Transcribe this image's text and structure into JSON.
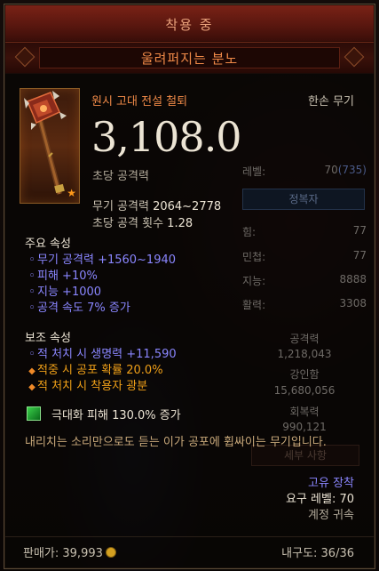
{
  "header": {
    "state_label": "착용 중",
    "item_name": "울려퍼지는 분노"
  },
  "item": {
    "type": "원시 고대 전설 철퇴",
    "slot": "한손 무기",
    "dps": "3,108.0",
    "dps_label": "초당 공격력",
    "weapon_damage_label": "무기 공격력",
    "weapon_damage_value": "2064~2778",
    "attacks_per_second_label": "초당 공격 횟수",
    "attacks_per_second_value": "1.28"
  },
  "primary": {
    "title": "주요 속성",
    "affixes": [
      "무기 공격력 +1560~1940",
      "피해 +10%",
      "지능 +1000",
      "공격 속도 7% 증가"
    ]
  },
  "secondary": {
    "title": "보조 속성",
    "affixes": [
      {
        "text": "적 처치 시 생명력 +11,590",
        "color": "#8a86ff",
        "bullet": "blue"
      },
      {
        "text": "적중 시 공포 확률 20.0%",
        "color": "#f0a018",
        "bullet": "orange"
      },
      {
        "text": "적 처치 시 착용자 광분",
        "color": "#f0a018",
        "bullet": "orange"
      }
    ]
  },
  "gem": {
    "icon": "green-gem-icon",
    "text": "극대화 피해 130.0% 증가"
  },
  "flavor": "내리치는 소리만으로도 듣는 이가 공포에 휩싸이는 무기입니다.",
  "tags": {
    "unique_equipped": "고유 장착",
    "required_level": "요구 레벨: 70",
    "account_bound": "계정 귀속"
  },
  "footer": {
    "sell_price": "판매가: 39,993",
    "durability": "내구도: 36/36"
  },
  "character_panel": {
    "level_label": "레벨:",
    "level_value": "70",
    "paragon_value": "(735)",
    "paragon_button": "정복자",
    "stats": [
      {
        "label": "힘:",
        "value": "77"
      },
      {
        "label": "민첩:",
        "value": "77"
      },
      {
        "label": "지능:",
        "value": "8888"
      },
      {
        "label": "활력:",
        "value": "3308"
      }
    ],
    "damage_label": "공격력",
    "damage_value": "1,218,043",
    "toughness_label": "강인함",
    "toughness_value": "15,680,056",
    "recovery_label": "회복력",
    "recovery_value": "990,121",
    "details_button": "세부 사항"
  },
  "colors": {
    "legendary_orange": "#f08a48",
    "magic_blue": "#8a86ff",
    "affix_orange": "#f0a018",
    "header_red": "#7a2216"
  }
}
